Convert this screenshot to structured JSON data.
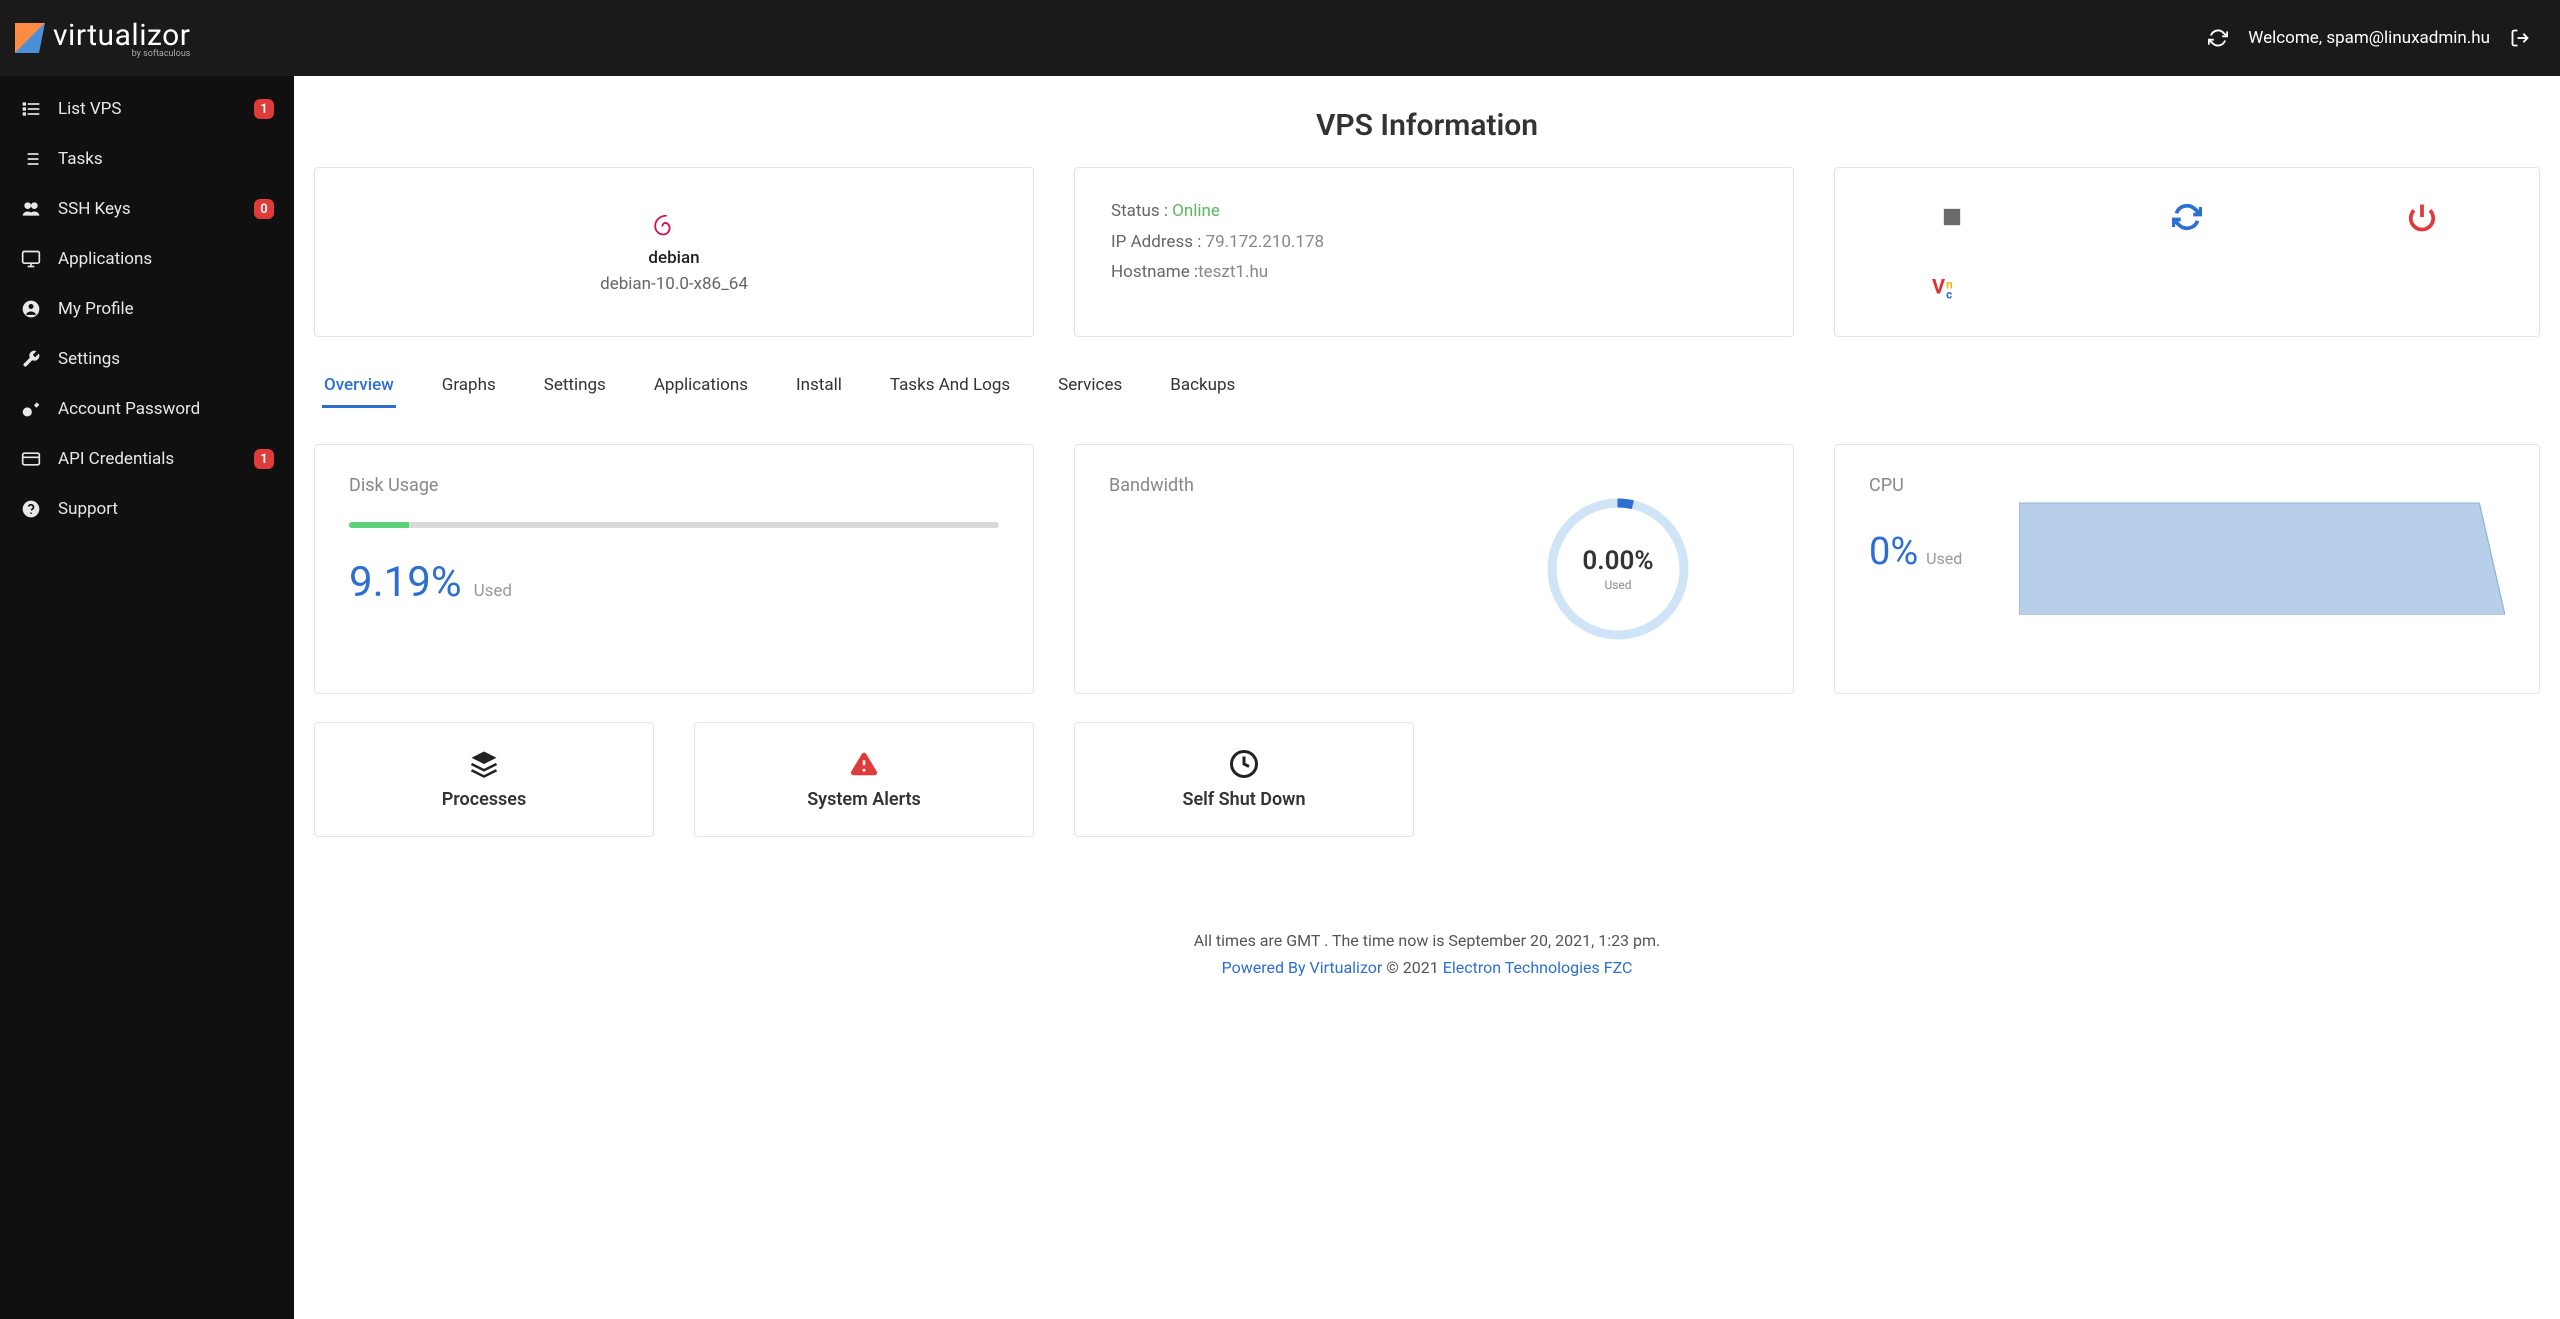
{
  "brand": {
    "name": "virtualizor",
    "by": "by softaculous"
  },
  "topbar": {
    "welcome_prefix": "Welcome, ",
    "user": "spam@linuxadmin.hu"
  },
  "sidebar": {
    "items": [
      {
        "label": "List VPS",
        "badge": "1"
      },
      {
        "label": "Tasks"
      },
      {
        "label": "SSH Keys",
        "badge": "0"
      },
      {
        "label": "Applications"
      },
      {
        "label": "My Profile"
      },
      {
        "label": "Settings"
      },
      {
        "label": "Account Password"
      },
      {
        "label": "API Credentials",
        "badge": "1"
      },
      {
        "label": "Support"
      }
    ]
  },
  "page": {
    "title": "VPS Information"
  },
  "os": {
    "distro": "debian",
    "name": "debian-10.0-x86_64"
  },
  "status": {
    "status_label": "Status : ",
    "status_value": "Online",
    "ip_label": "IP Address : ",
    "ip_value": "79.172.210.178",
    "hostname_label": "Hostname :",
    "hostname_value": "teszt1.hu"
  },
  "tabs": [
    "Overview",
    "Graphs",
    "Settings",
    "Applications",
    "Install",
    "Tasks And Logs",
    "Services",
    "Backups"
  ],
  "disk": {
    "title": "Disk Usage",
    "percent": "9.19%",
    "used_label": "Used"
  },
  "bandwidth": {
    "title": "Bandwidth",
    "percent": "0.00%",
    "used_label": "Used"
  },
  "cpu": {
    "title": "CPU",
    "percent": "0%",
    "used_label": "Used"
  },
  "quick": {
    "processes": "Processes",
    "alerts": "System Alerts",
    "shutdown": "Self Shut Down"
  },
  "footer": {
    "time_text": "All times are GMT . The time now is September 20, 2021, 1:23 pm.",
    "powered": "Powered By Virtualizor",
    "copyright": " © 2021 ",
    "company": "Electron Technologies FZC"
  },
  "chart_data": {
    "type": "area",
    "title": "CPU",
    "xlabel": "",
    "ylabel": "",
    "x": [
      0,
      1,
      2,
      3,
      4,
      5,
      6,
      7,
      8,
      9,
      10,
      11,
      12,
      13,
      14,
      15,
      16,
      17,
      18,
      19
    ],
    "values": [
      80,
      80,
      80,
      80,
      80,
      80,
      80,
      80,
      80,
      80,
      80,
      80,
      80,
      80,
      80,
      80,
      80,
      80,
      80,
      0
    ],
    "ylim": [
      0,
      100
    ]
  }
}
